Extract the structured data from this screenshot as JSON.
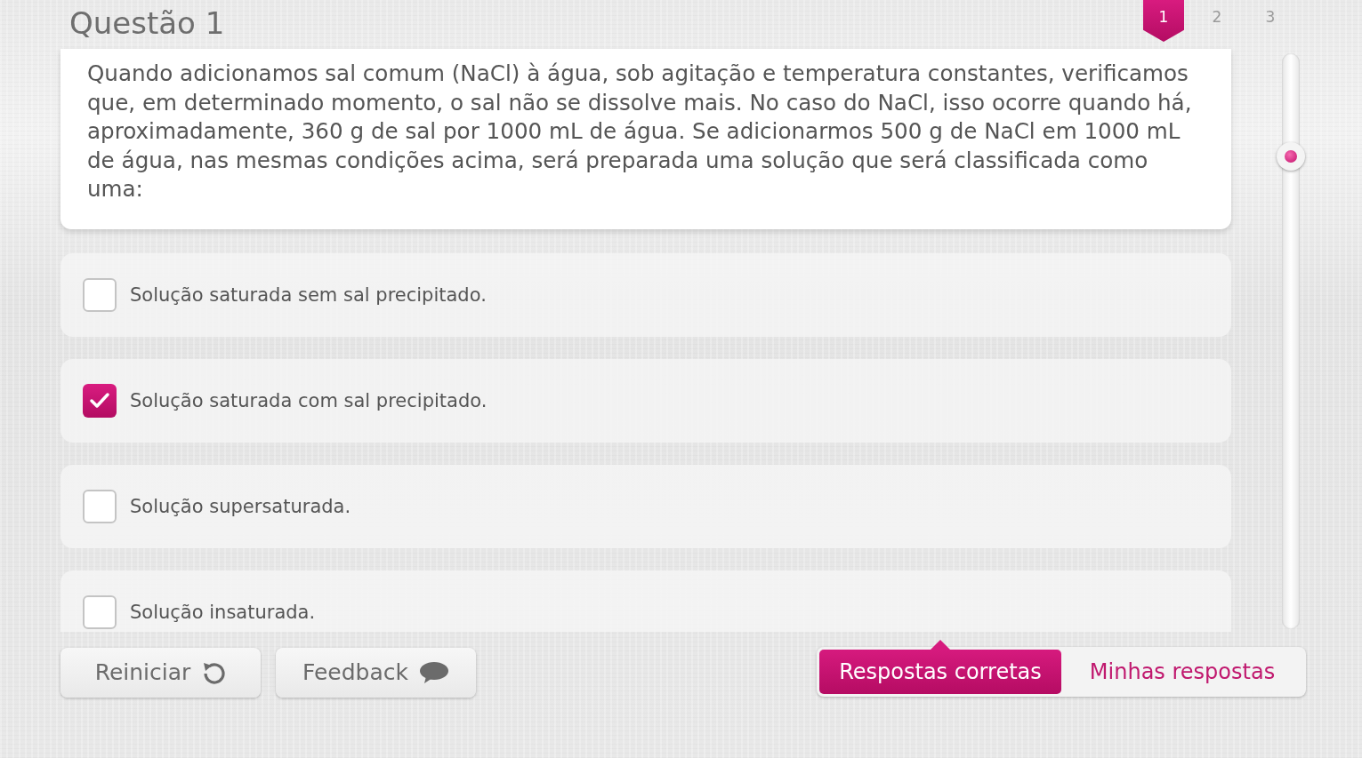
{
  "title": "Questão 1",
  "pages": [
    {
      "label": "1",
      "selected": true
    },
    {
      "label": "2",
      "selected": false
    },
    {
      "label": "3",
      "selected": false
    }
  ],
  "question": "Quando adicionamos sal comum (NaCl) à água, sob agitação e temperatura constantes, verificamos que, em determinado momento, o sal não se dissolve mais. No caso do NaCl, isso ocorre quando há, aproximadamente, 360 g de sal por 1000 mL de água. Se adicionarmos 500 g de NaCl em 1000 mL de água, nas mesmas condições acima, será preparada uma solução que será classificada como uma:",
  "options": [
    {
      "label": "Solução saturada sem sal precipitado.",
      "checked": false
    },
    {
      "label": "Solução saturada com sal precipitado.",
      "checked": true
    },
    {
      "label": "Solução supersaturada.",
      "checked": false
    },
    {
      "label": "Solução insaturada.",
      "checked": false
    }
  ],
  "actions": [
    {
      "label": "Reiniciar",
      "kind": "restart"
    },
    {
      "label": "Feedback",
      "kind": "feedback"
    }
  ],
  "views": [
    {
      "label": "Respostas corretas",
      "selected": true
    },
    {
      "label": "Minhas respostas",
      "selected": false
    }
  ]
}
